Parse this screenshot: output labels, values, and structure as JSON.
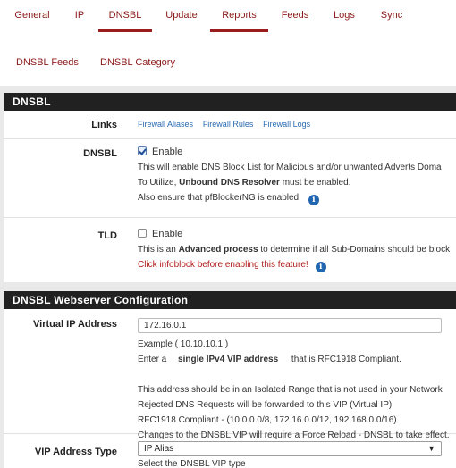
{
  "tabs": [
    {
      "label": "General",
      "active": false
    },
    {
      "label": "IP",
      "active": false
    },
    {
      "label": "DNSBL",
      "active": true
    },
    {
      "label": "Update",
      "active": false
    },
    {
      "label": "Reports",
      "active": true
    },
    {
      "label": "Feeds",
      "active": false
    },
    {
      "label": "Logs",
      "active": false
    },
    {
      "label": "Sync",
      "active": false
    }
  ],
  "subtabs": [
    "DNSBL Feeds",
    "DNSBL Category"
  ],
  "dnsbl_panel": {
    "title": "DNSBL",
    "links": {
      "label": "Links",
      "items": [
        "Firewall Aliases",
        "Firewall Rules",
        "Firewall Logs"
      ]
    },
    "dnsbl": {
      "label": "DNSBL",
      "checkbox_label": "Enable",
      "checked": true,
      "help1": "This will enable DNS Block List for Malicious and/or unwanted Adverts Doma",
      "help2_pre": "To Utilize, ",
      "help2_bold": "Unbound DNS Resolver",
      "help2_post": " must be enabled.",
      "help3": "Also ensure that pfBlockerNG is enabled."
    },
    "tld": {
      "label": "TLD",
      "checkbox_label": "Enable",
      "checked": false,
      "help1_pre": "This is an ",
      "help1_bold": "Advanced process",
      "help1_post": " to determine if all Sub-Domains should be block",
      "warning": "Click infoblock before enabling this feature!"
    }
  },
  "webserver_panel": {
    "title": "DNSBL Webserver Configuration",
    "vip": {
      "label": "Virtual IP Address",
      "value": "172.16.0.1",
      "example": "Example ( 10.10.10.1 )",
      "enter_pre": "Enter a",
      "enter_bold": "single IPv4 VIP address",
      "enter_post": "that is RFC1918 Compliant.",
      "note1": "This address should be in an Isolated Range that is not used in your Network",
      "note2": "Rejected DNS Requests will be forwarded to this VIP (Virtual IP)",
      "note3": "RFC1918 Compliant - (10.0.0.0/8, 172.16.0.0/12, 192.168.0.0/16)",
      "note4": "Changes to the DNSBL VIP will require a Force Reload - DNSBL to take effect."
    },
    "vip_type": {
      "label": "VIP Address Type",
      "selected": "IP Alias",
      "help": "Select the DNSBL VIP type"
    }
  },
  "icons": {
    "info": "info-circle-icon",
    "checkbox": "checkbox-icon",
    "dropdown": "chevron-down-icon"
  },
  "colors": {
    "link": "#2a6bb0",
    "tab_text": "#8b1a1a",
    "active_underline": "#9b1c1c",
    "panel_header": "#212121",
    "warning": "#b01c1c"
  }
}
